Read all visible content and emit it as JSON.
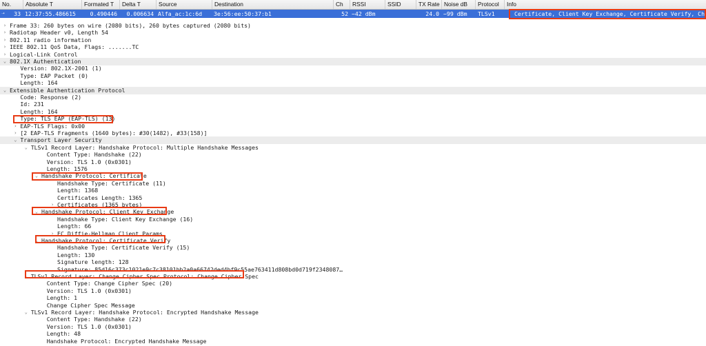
{
  "packet_list": {
    "columns": [
      "No.",
      "Absolute T",
      "Formated T",
      "Delta T",
      "Source",
      "Destination",
      "Ch",
      "RSSI",
      "SSID",
      "TX Rate",
      "Noise dB",
      "Protocol",
      "Info"
    ],
    "selected_row": {
      "no": "33",
      "absolute_time": "12:37:55.486615",
      "formatted_time": "0.490446",
      "delta_time": "0.006634",
      "source": "Alfa_ac:1c:6d",
      "destination": "3e:56:ee:50:37:b1",
      "channel": "52",
      "rssi": "−42 dBm",
      "ssid": "",
      "tx_rate": "24.0",
      "noise": "−99 dBm",
      "protocol": "TLSv1",
      "info": "Certificate, Client Key Exchange, Certificate Verify, Chang"
    }
  },
  "details": [
    {
      "text": "Frame 33: 260 bytes on wire (2080 bits), 260 bytes captured (2080 bits)",
      "toggle": "collapsed",
      "level": 0
    },
    {
      "text": "Radiotap Header v0, Length 54",
      "toggle": "collapsed",
      "level": 0
    },
    {
      "text": "802.11 radio information",
      "toggle": "collapsed",
      "level": 0
    },
    {
      "text": "IEEE 802.11 QoS Data, Flags: .......TC",
      "toggle": "collapsed",
      "level": 0
    },
    {
      "text": "Logical-Link Control",
      "toggle": "collapsed",
      "level": 0
    },
    {
      "text": "802.1X Authentication",
      "toggle": "expanded",
      "level": 0,
      "section": true
    },
    {
      "text": "Version: 802.1X-2001 (1)",
      "level": 2
    },
    {
      "text": "Type: EAP Packet (0)",
      "level": 2
    },
    {
      "text": "Length: 164",
      "level": 2
    },
    {
      "text": "Extensible Authentication Protocol",
      "toggle": "expanded",
      "level": 0,
      "section": true
    },
    {
      "text": "Code: Response (2)",
      "level": 2
    },
    {
      "text": "Id: 231",
      "level": 2
    },
    {
      "text": "Length: 164",
      "level": 2
    },
    {
      "text": "Type: TLS EAP (EAP-TLS) (13)",
      "level": 2
    },
    {
      "text": "EAP-TLS Flags: 0x00",
      "toggle": "collapsed",
      "level": 2
    },
    {
      "text": "[2 EAP-TLS Fragments (1640 bytes): #30(1482), #33(158)]",
      "toggle": "collapsed",
      "level": 2
    },
    {
      "text": "Transport Layer Security",
      "toggle": "expanded",
      "level": 2,
      "section": true
    },
    {
      "text": "TLSv1 Record Layer: Handshake Protocol: Multiple Handshake Messages",
      "toggle": "expanded",
      "level": 4
    },
    {
      "text": "Content Type: Handshake (22)",
      "level": 7
    },
    {
      "text": "Version: TLS 1.0 (0x0301)",
      "level": 7
    },
    {
      "text": "Length: 1576",
      "level": 7
    },
    {
      "text": "Handshake Protocol: Certificate",
      "toggle": "expanded",
      "level": 6
    },
    {
      "text": "Handshake Type: Certificate (11)",
      "level": 9
    },
    {
      "text": "Length: 1368",
      "level": 9
    },
    {
      "text": "Certificates Length: 1365",
      "level": 9
    },
    {
      "text": "Certificates (1365 bytes)",
      "toggle": "collapsed",
      "level": 9
    },
    {
      "text": "Handshake Protocol: Client Key Exchange",
      "toggle": "expanded",
      "level": 6
    },
    {
      "text": "Handshake Type: Client Key Exchange (16)",
      "level": 9
    },
    {
      "text": "Length: 66",
      "level": 9
    },
    {
      "text": "EC Diffie-Hellman Client Params",
      "toggle": "collapsed",
      "level": 9
    },
    {
      "text": "Handshake Protocol: Certificate Verify",
      "toggle": "expanded",
      "level": 6
    },
    {
      "text": "Handshake Type: Certificate Verify (15)",
      "level": 9
    },
    {
      "text": "Length: 130",
      "level": 9
    },
    {
      "text": "Signature length: 128",
      "level": 9
    },
    {
      "text": "Signature: 85d16c373c1021e9c7c38101bb2a0a66742ded4bf9c55ae763411d808bd0d719f2348087…",
      "level": 9
    },
    {
      "text": "TLSv1 Record Layer: Change Cipher Spec Protocol: Change Cipher Spec",
      "toggle": "expanded",
      "level": 4
    },
    {
      "text": "Content Type: Change Cipher Spec (20)",
      "level": 7
    },
    {
      "text": "Version: TLS 1.0 (0x0301)",
      "level": 7
    },
    {
      "text": "Length: 1",
      "level": 7
    },
    {
      "text": "Change Cipher Spec Message",
      "level": 7
    },
    {
      "text": "TLSv1 Record Layer: Handshake Protocol: Encrypted Handshake Message",
      "toggle": "expanded",
      "level": 4
    },
    {
      "text": "Content Type: Handshake (22)",
      "level": 7
    },
    {
      "text": "Version: TLS 1.0 (0x0301)",
      "level": 7
    },
    {
      "text": "Length: 48",
      "level": 7
    },
    {
      "text": "Handshake Protocol: Encrypted Handshake Message",
      "level": 7
    }
  ],
  "highlights": {
    "color": "#e83a14"
  },
  "icons": {
    "collapsed": "chevron-right-icon",
    "expanded": "chevron-down-icon"
  },
  "colors": {
    "selection": "#3a6fd8",
    "section_background": "#ececec"
  }
}
